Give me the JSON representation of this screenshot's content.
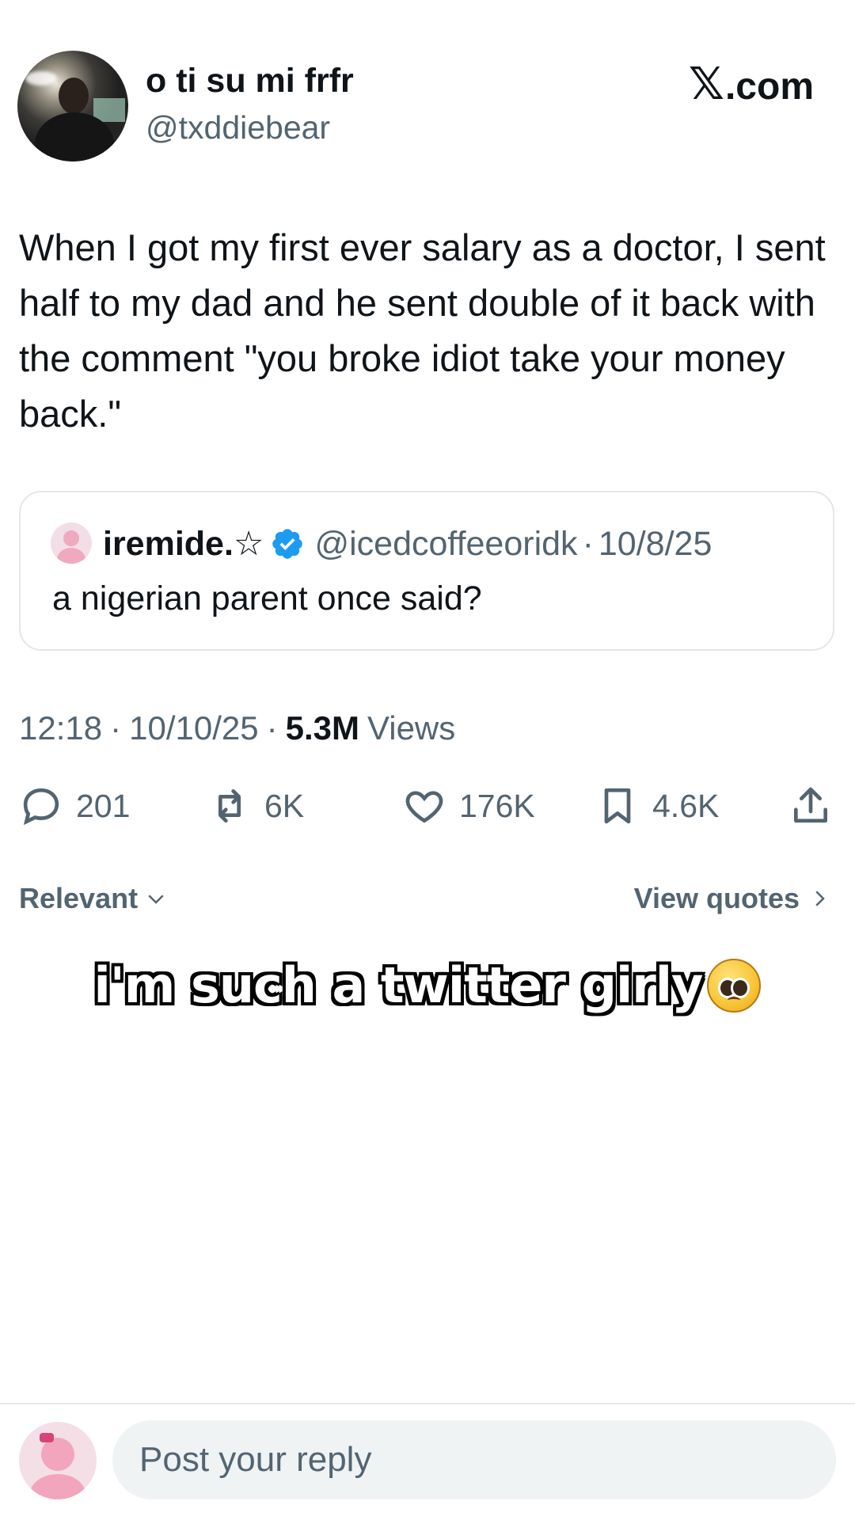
{
  "header": {
    "display_name": "o ti su mi frfr",
    "handle": "@txddiebear",
    "site_logo": "𝕏",
    "site_label": ".com"
  },
  "tweet": {
    "text": "When I got my first ever salary as a doctor, I sent half to my dad and he sent double of it back with the comment \"you broke idiot take your money back.\""
  },
  "quote": {
    "name": "iremide.☆",
    "verified": true,
    "handle": "@icedcoffeeoridk",
    "separator": "·",
    "date": "10/8/25",
    "text": "a nigerian parent once said?"
  },
  "meta": {
    "time": "12:18",
    "dot": "·",
    "date": "10/10/25",
    "views_count": "5.3M",
    "views_label": "Views"
  },
  "actions": {
    "replies": "201",
    "reposts": "6K",
    "likes": "176K",
    "bookmarks": "4.6K"
  },
  "filters": {
    "sort_label": "Relevant",
    "view_quotes_label": "View quotes"
  },
  "overlay": {
    "caption": "i'm such a twitter girly",
    "emoji": "pleading-face-emoji"
  },
  "reply_bar": {
    "placeholder": "Post your reply"
  },
  "colors": {
    "text": "#0f1419",
    "secondary": "#536471",
    "verified": "#1d9bf0",
    "border": "#e3e7ea",
    "input_bg": "#eff3f4"
  }
}
